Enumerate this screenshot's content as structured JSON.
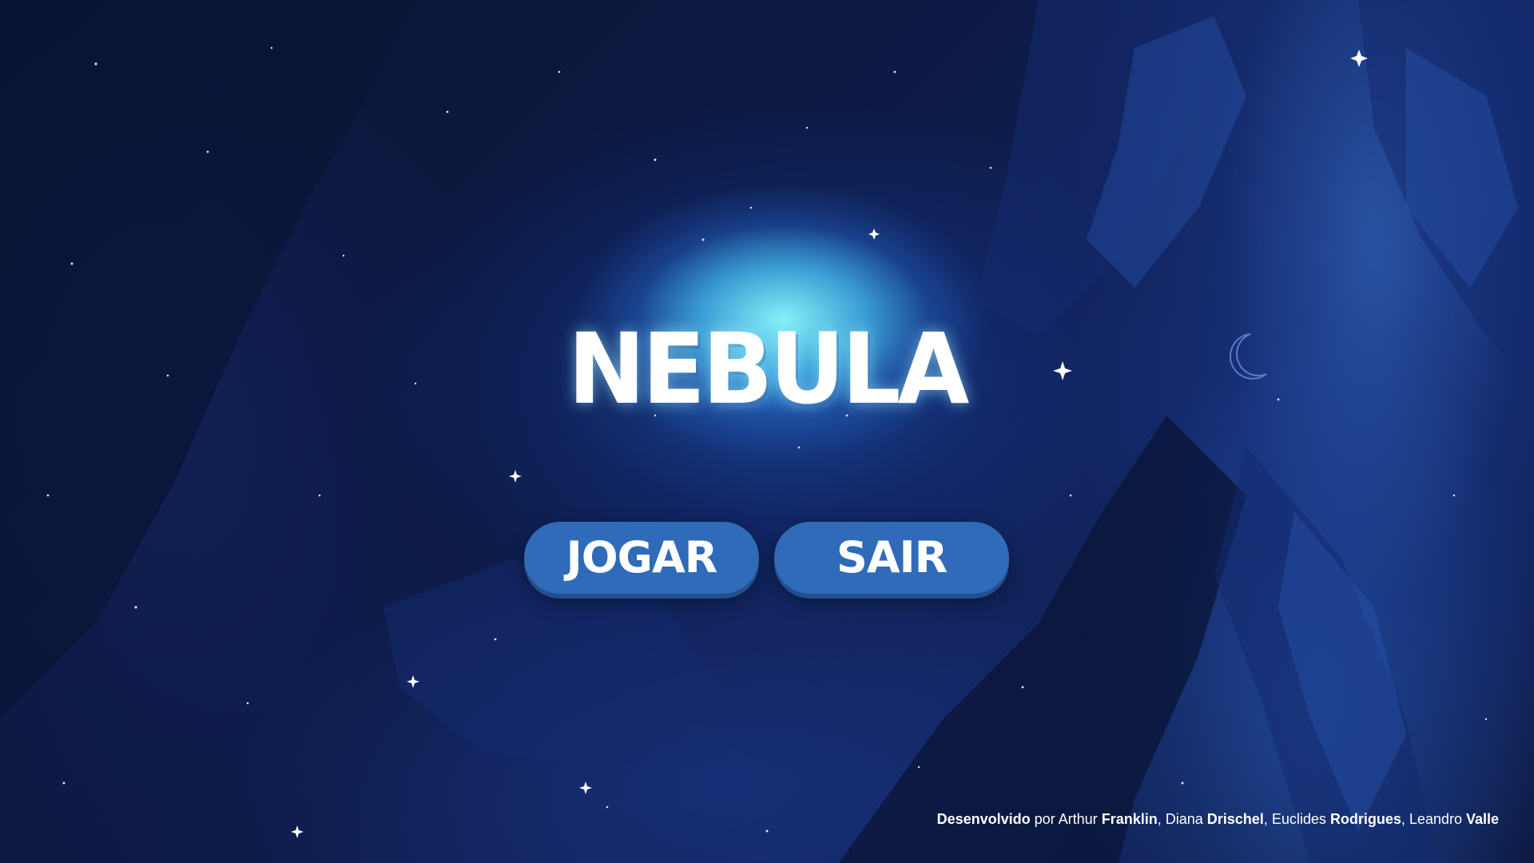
{
  "game": {
    "title": "NEBULA"
  },
  "menu": {
    "play_label": "JOGAR",
    "exit_label": "SAIR"
  },
  "credits": {
    "prefix": "Desenvolvido",
    "by": " por ",
    "dev1_first": "Arthur ",
    "dev1_last": "Franklin",
    "sep1": ", ",
    "dev2_first": "Diana ",
    "dev2_last": "Drischel",
    "sep2": ", ",
    "dev3_first": "Euclides ",
    "dev3_last": "Rodrigues",
    "sep3": ", ",
    "dev4_first": "Leandro ",
    "dev4_last": "Valle"
  },
  "colors": {
    "button": "#2f6bb8",
    "background": "#0d1a45",
    "nebula_glow": "#8cfaff"
  }
}
